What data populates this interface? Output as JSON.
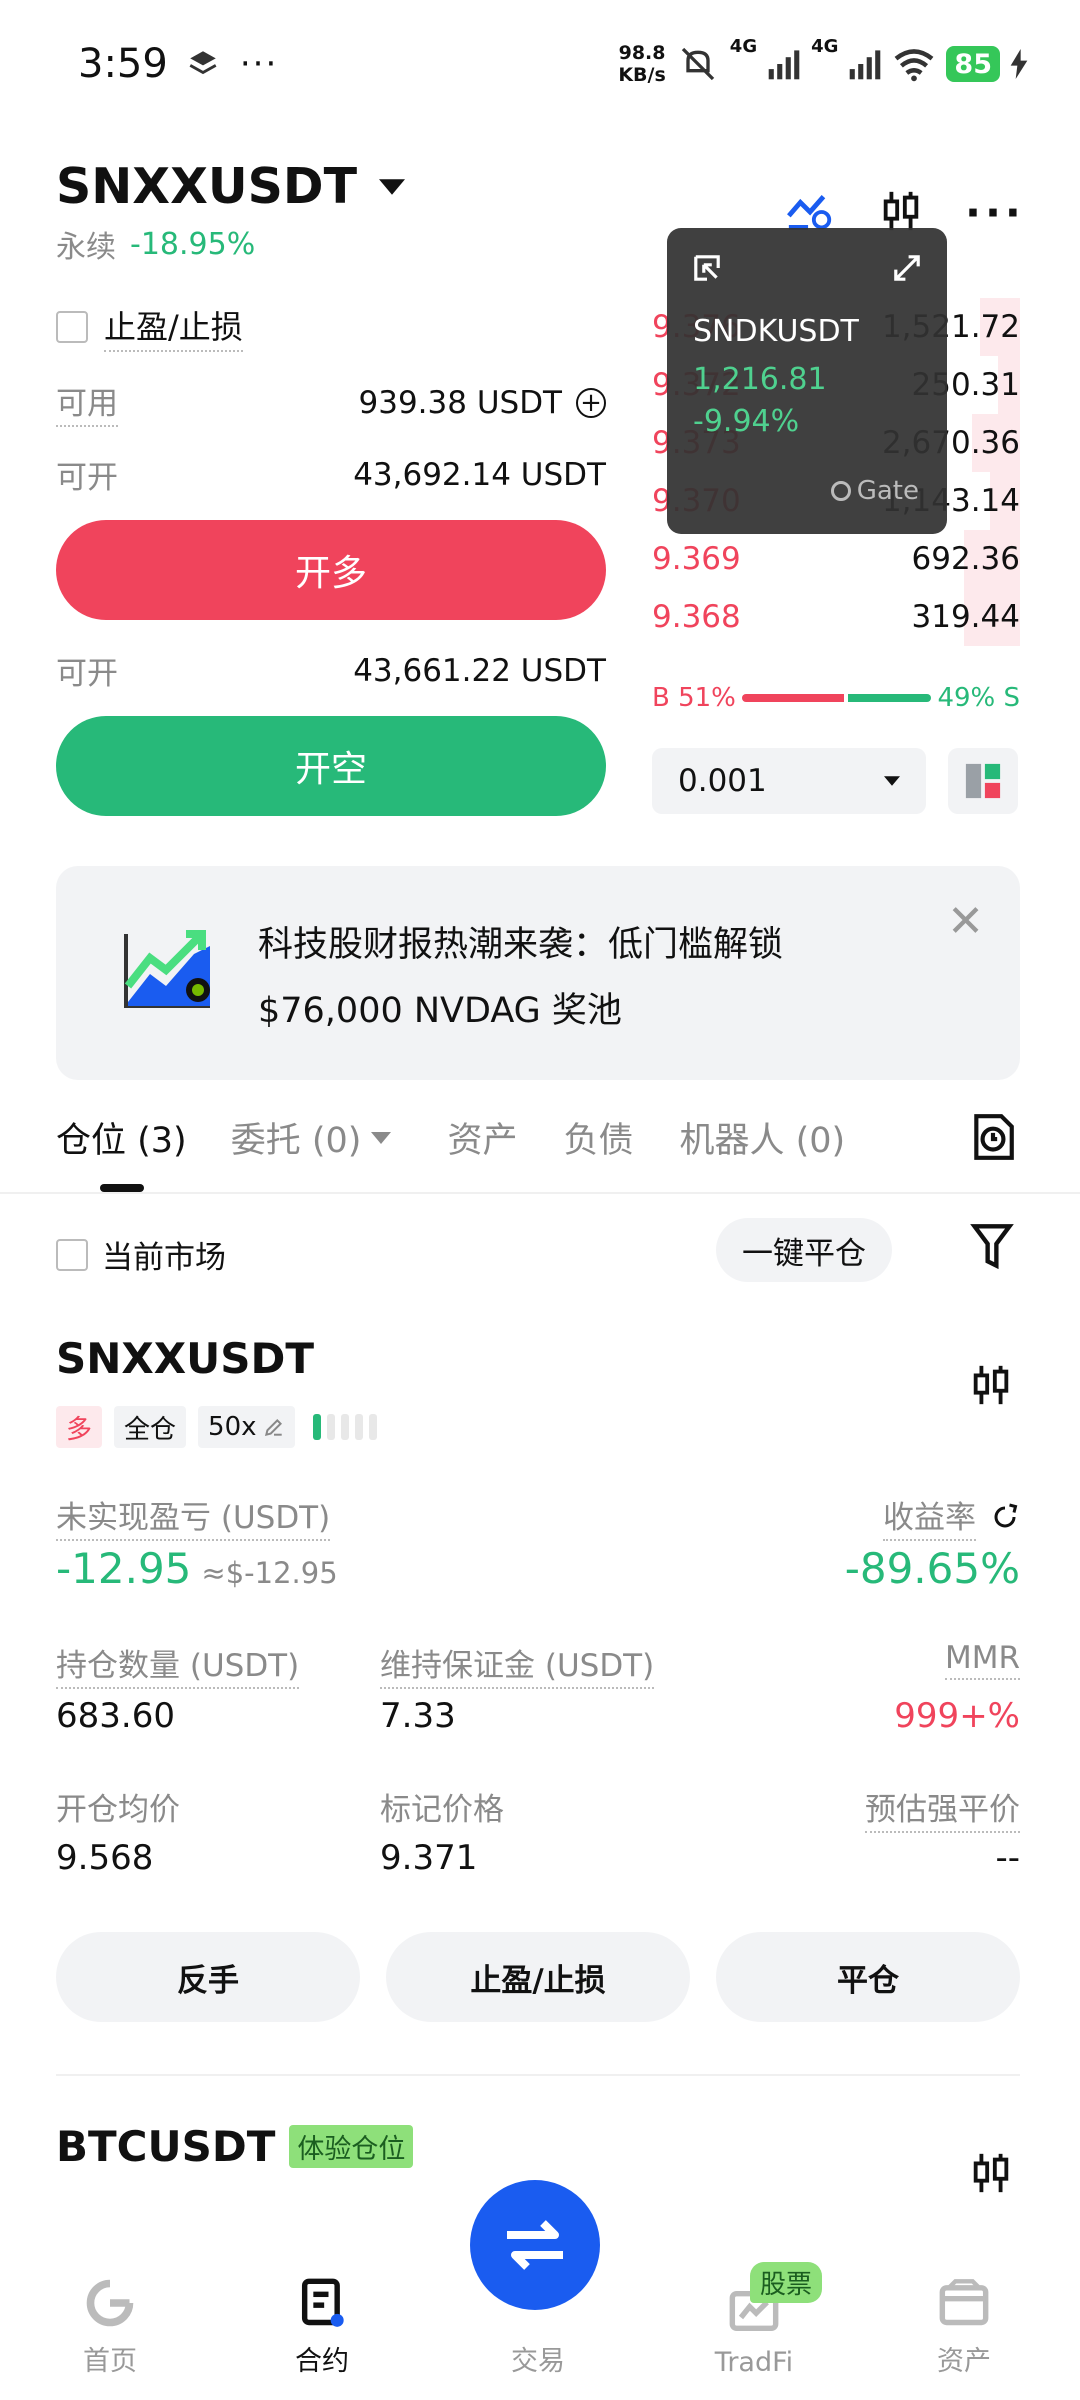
{
  "status_bar": {
    "time": "3:59",
    "net_speed_top": "98.8",
    "net_speed_unit": "KB/s",
    "net1": "4G",
    "net2": "4G",
    "battery": "85"
  },
  "header": {
    "symbol": "SNXXUSDT",
    "contract_type": "永续",
    "change": "-18.95%"
  },
  "order_form": {
    "tp_sl_label": "止盈/止损",
    "available_label": "可用",
    "available_value": "939.38 USDT",
    "open_long_label": "可开",
    "open_long_value": "43,692.14 USDT",
    "long_button": "开多",
    "open_short_label": "可开",
    "open_short_value": "43,661.22 USDT",
    "short_button": "开空"
  },
  "orderbook": {
    "rows": [
      {
        "price": "9.376",
        "qty": "1,521.72"
      },
      {
        "price": "9.372",
        "qty": "250.31"
      },
      {
        "price": "9.373",
        "qty": "2,670.36"
      },
      {
        "price": "9.370",
        "qty": "1,143.14"
      },
      {
        "price": "9.369",
        "qty": "692.36"
      },
      {
        "price": "9.368",
        "qty": "319.44"
      }
    ],
    "buy_pct": "B 51%",
    "sell_pct": "49% S",
    "buy_ratio": 0.51,
    "precision": "0.001"
  },
  "floating_window": {
    "symbol": "SNDKUSDT",
    "price": "1,216.81",
    "change": "-9.94%",
    "brand": "Gate"
  },
  "banner": {
    "line1": "科技股财报热潮来袭：低门槛解锁",
    "line2": "$76,000 NVDAG 奖池"
  },
  "tabs": [
    {
      "label": "仓位 (3)",
      "active": true
    },
    {
      "label": "委托 (0)",
      "active": false
    },
    {
      "label": "资产",
      "active": false
    },
    {
      "label": "负债",
      "active": false
    },
    {
      "label": "机器人 (0)",
      "active": false
    }
  ],
  "filters": {
    "current_market": "当前市场",
    "close_all": "一键平仓"
  },
  "position1": {
    "symbol": "SNXXUSDT",
    "side": "多",
    "margin_mode": "全仓",
    "leverage": "50x",
    "upnl_label": "未实现盈亏 (USDT)",
    "upnl_value": "-12.95",
    "upnl_usd": "≈$-12.95",
    "roe_label": "收益率",
    "roe_value": "-89.65%",
    "size_label": "持仓数量 (USDT)",
    "size_value": "683.60",
    "mm_label": "维持保证金 (USDT)",
    "mm_value": "7.33",
    "mmr_label": "MMR",
    "mmr_value": "999+%",
    "entry_label": "开仓均价",
    "entry_value": "9.568",
    "mark_label": "标记价格",
    "mark_value": "9.371",
    "liq_label": "预估强平价",
    "liq_value": "--",
    "btn_reverse": "反手",
    "btn_tpsl": "止盈/止损",
    "btn_close": "平仓"
  },
  "position2": {
    "symbol": "BTCUSDT",
    "badge": "体验仓位"
  },
  "bottom_nav": [
    {
      "label": "首页",
      "active": false
    },
    {
      "label": "合约",
      "active": true
    },
    {
      "label": "交易",
      "active": false
    },
    {
      "label": "TradFi",
      "active": false,
      "badge": "股票"
    },
    {
      "label": "资产",
      "active": false
    }
  ],
  "colors": {
    "green": "#27b979",
    "red": "#f0445c",
    "nav_blue": "#1a5cf0"
  }
}
